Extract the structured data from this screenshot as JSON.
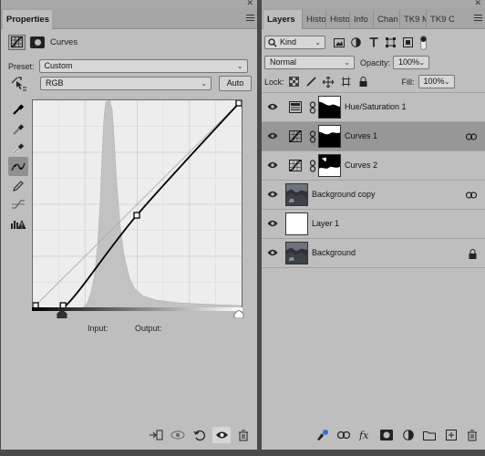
{
  "properties": {
    "tab": "Properties",
    "adjustment_title": "Curves",
    "preset_label": "Preset:",
    "preset_value": "Custom",
    "channel_value": "RGB",
    "auto_label": "Auto",
    "input_label": "Input:",
    "output_label": "Output:"
  },
  "layers_panel": {
    "tabs": [
      "Layers",
      "Histo",
      "Histo",
      "Info",
      "Chan",
      "TK9 M",
      "TK9 C"
    ],
    "filter_value": "Kind",
    "blend_mode": "Normal",
    "opacity_label": "Opacity:",
    "opacity_value": "100%",
    "lock_label": "Lock:",
    "fill_label": "Fill:",
    "fill_value": "100%",
    "layers": [
      {
        "name": "Hue/Saturation 1",
        "type": "adjustment",
        "adjustment_icon": "hue-saturation-icon",
        "selected": false
      },
      {
        "name": "Curves 1",
        "type": "adjustment",
        "adjustment_icon": "curves-icon",
        "selected": true
      },
      {
        "name": "Curves 2",
        "type": "adjustment",
        "adjustment_icon": "curves-icon",
        "selected": false
      },
      {
        "name": "Background copy",
        "type": "image",
        "selected": false
      },
      {
        "name": "Layer 1",
        "type": "blank",
        "selected": false
      },
      {
        "name": "Background",
        "type": "image",
        "selected": false,
        "locked": true
      }
    ]
  },
  "curve": {
    "points": [
      [
        0,
        0
      ],
      [
        37,
        0
      ],
      [
        127,
        114
      ],
      [
        255,
        255
      ]
    ],
    "range": [
      0,
      255
    ]
  }
}
